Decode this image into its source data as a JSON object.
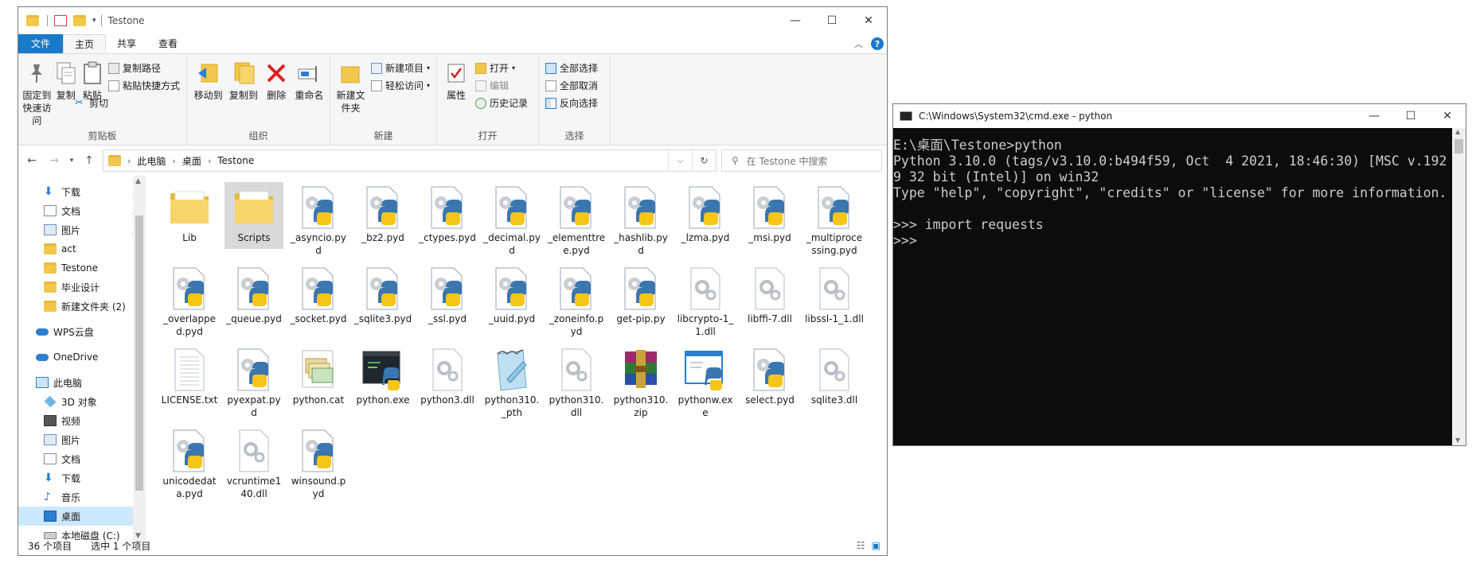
{
  "explorer": {
    "title": "Testone",
    "tabs": [
      "文件",
      "主页",
      "共享",
      "查看"
    ],
    "ribbon": {
      "clipboard": {
        "pin": "固定到快速访问",
        "copy": "复制",
        "paste": "粘贴",
        "copy_path": "复制路径",
        "paste_shortcut": "粘贴快捷方式",
        "cut": "剪切",
        "label": "剪贴板"
      },
      "organize": {
        "move_to": "移动到",
        "copy_to": "复制到",
        "delete": "删除",
        "rename": "重命名",
        "label": "组织"
      },
      "new": {
        "new_folder": "新建文件夹",
        "new_item": "新建项目",
        "easy_access": "轻松访问",
        "label": "新建"
      },
      "open": {
        "properties": "属性",
        "open": "打开",
        "edit": "编辑",
        "history": "历史记录",
        "label": "打开"
      },
      "select": {
        "select_all": "全部选择",
        "select_none": "全部取消",
        "invert": "反向选择",
        "label": "选择"
      }
    },
    "address": {
      "parts": [
        "此电脑",
        "桌面",
        "Testone"
      ]
    },
    "search": {
      "placeholder": "在 Testone 中搜索"
    },
    "nav": [
      {
        "label": "下载",
        "icon": "download-icon",
        "level": 2,
        "pinned": true
      },
      {
        "label": "文档",
        "icon": "document-icon",
        "level": 2,
        "pinned": true
      },
      {
        "label": "图片",
        "icon": "picture-icon",
        "level": 2,
        "pinned": true
      },
      {
        "label": "act",
        "icon": "folder-icon",
        "level": 2
      },
      {
        "label": "Testone",
        "icon": "folder-icon",
        "level": 2
      },
      {
        "label": "毕业设计",
        "icon": "folder-icon",
        "level": 2
      },
      {
        "label": "新建文件夹 (2)",
        "icon": "folder-icon",
        "level": 2
      },
      {
        "gap": true
      },
      {
        "label": "WPS云盘",
        "icon": "cloud-icon",
        "level": 1
      },
      {
        "gap": true
      },
      {
        "label": "OneDrive",
        "icon": "cloud-icon",
        "level": 1
      },
      {
        "gap": true
      },
      {
        "label": "此电脑",
        "icon": "computer-icon",
        "level": 1
      },
      {
        "label": "3D 对象",
        "icon": "cube-icon",
        "level": 2
      },
      {
        "label": "视频",
        "icon": "video-icon",
        "level": 2
      },
      {
        "label": "图片",
        "icon": "picture-icon",
        "level": 2
      },
      {
        "label": "文档",
        "icon": "document-icon",
        "level": 2
      },
      {
        "label": "下载",
        "icon": "download-icon",
        "level": 2
      },
      {
        "label": "音乐",
        "icon": "music-icon",
        "level": 2
      },
      {
        "label": "桌面",
        "icon": "desktop-icon",
        "level": 2,
        "selected": true
      },
      {
        "label": "本地磁盘 (C:)",
        "icon": "drive-icon",
        "level": 2
      }
    ],
    "files": [
      {
        "name": "Lib",
        "type": "folder"
      },
      {
        "name": "Scripts",
        "type": "folder",
        "selected": true
      },
      {
        "name": "_asyncio.pyd",
        "type": "pyd"
      },
      {
        "name": "_bz2.pyd",
        "type": "pyd"
      },
      {
        "name": "_ctypes.pyd",
        "type": "pyd"
      },
      {
        "name": "_decimal.pyd",
        "type": "pyd"
      },
      {
        "name": "_elementtree.pyd",
        "type": "pyd"
      },
      {
        "name": "_hashlib.pyd",
        "type": "pyd"
      },
      {
        "name": "_lzma.pyd",
        "type": "pyd"
      },
      {
        "name": "_msi.pyd",
        "type": "pyd"
      },
      {
        "name": "_multiprocessing.pyd",
        "type": "pyd"
      },
      {
        "name": "_overlapped.pyd",
        "type": "pyd"
      },
      {
        "name": "_queue.pyd",
        "type": "pyd"
      },
      {
        "name": "_socket.pyd",
        "type": "pyd"
      },
      {
        "name": "_sqlite3.pyd",
        "type": "pyd"
      },
      {
        "name": "_ssl.pyd",
        "type": "pyd"
      },
      {
        "name": "_uuid.pyd",
        "type": "pyd"
      },
      {
        "name": "_zoneinfo.pyd",
        "type": "pyd"
      },
      {
        "name": "get-pip.py",
        "type": "py"
      },
      {
        "name": "libcrypto-1_1.dll",
        "type": "dll"
      },
      {
        "name": "libffi-7.dll",
        "type": "dll"
      },
      {
        "name": "libssl-1_1.dll",
        "type": "dll"
      },
      {
        "name": "LICENSE.txt",
        "type": "txt"
      },
      {
        "name": "pyexpat.pyd",
        "type": "pyd"
      },
      {
        "name": "python.cat",
        "type": "cat"
      },
      {
        "name": "python.exe",
        "type": "exe"
      },
      {
        "name": "python3.dll",
        "type": "dll"
      },
      {
        "name": "python310._pth",
        "type": "pth"
      },
      {
        "name": "python310.dll",
        "type": "dll"
      },
      {
        "name": "python310.zip",
        "type": "zip"
      },
      {
        "name": "pythonw.exe",
        "type": "exew"
      },
      {
        "name": "select.pyd",
        "type": "pyd"
      },
      {
        "name": "sqlite3.dll",
        "type": "dll"
      },
      {
        "name": "unicodedata.pyd",
        "type": "pyd"
      },
      {
        "name": "vcruntime140.dll",
        "type": "dll"
      },
      {
        "name": "winsound.pyd",
        "type": "pyd"
      }
    ],
    "status": {
      "count": "36 个项目",
      "selected": "选中 1 个项目"
    }
  },
  "cmd": {
    "title": "C:\\Windows\\System32\\cmd.exe - python",
    "lines": [
      "E:\\桌面\\Testone>python",
      "Python 3.10.0 (tags/v3.10.0:b494f59, Oct  4 2021, 18:46:30) [MSC v.192",
      "9 32 bit (Intel)] on win32",
      "Type \"help\", \"copyright\", \"credits\" or \"license\" for more information.",
      "",
      ">>> import requests",
      ">>> "
    ]
  },
  "colors": {
    "accent": "#1979ca",
    "folder": "#f3c74b",
    "selection": "#cce8ff",
    "console_bg": "#0c0c0c"
  }
}
